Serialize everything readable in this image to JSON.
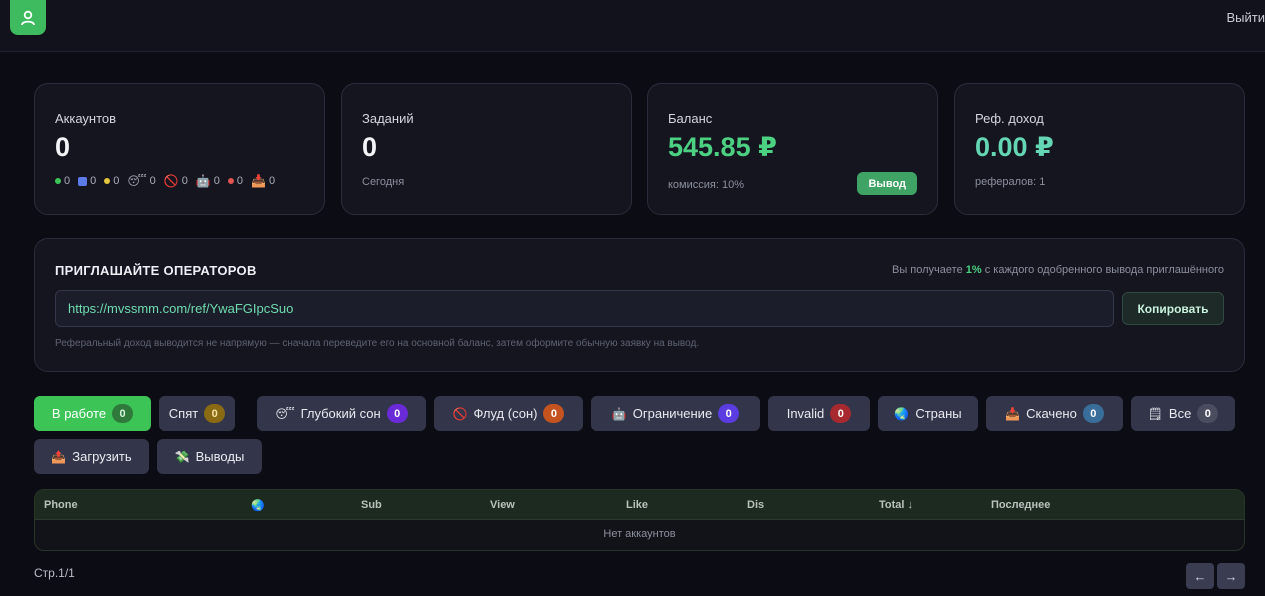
{
  "header": {
    "logout_label": "Выйти"
  },
  "stats": {
    "accounts": {
      "label": "Аккаунтов",
      "value": "0",
      "mini": [
        {
          "icon": "green-dot",
          "color": "#3cc457",
          "count": "0"
        },
        {
          "icon": "blue-square-icon",
          "count": "0"
        },
        {
          "icon": "yellow-dot",
          "color": "#e6c63d",
          "count": "0"
        },
        {
          "icon": "sleepy-face-icon",
          "count": "0"
        },
        {
          "icon": "prohibited-icon",
          "count": "0"
        },
        {
          "icon": "robot-face-icon",
          "count": "0"
        },
        {
          "icon": "red-dot",
          "color": "#e0554f",
          "count": "0"
        },
        {
          "icon": "inbox-tray-icon",
          "count": "0"
        }
      ]
    },
    "tasks": {
      "label": "Заданий",
      "value": "0",
      "sub": "Сегодня"
    },
    "balance": {
      "label": "Баланс",
      "value": "545.85 ₽",
      "sub": "комиссия: 10%",
      "withdraw_label": "Вывод"
    },
    "ref_income": {
      "label": "Реф. доход",
      "value": "0.00 ₽",
      "sub": "рефералов: 1"
    }
  },
  "invite": {
    "title": "ПРИГЛАШАЙТЕ ОПЕРАТОРОВ",
    "note_prefix": "Вы получаете ",
    "note_percent": "1%",
    "note_suffix": " с каждого одобренного вывода приглашённого",
    "ref_link": "https://mvssmm.com/ref/YwaFGIpcSuo",
    "copy_label": "Копировать",
    "hint": "Реферальный доход выводится не напрямую — сначала переведите его на основной баланс, затем оформите обычную заявку на вывод."
  },
  "filters": [
    {
      "label": "В работе",
      "count": "0"
    },
    {
      "label": "Спят",
      "count": "0"
    },
    {
      "label": "Глубокий сон",
      "count": "0",
      "icon": "sleepy-face-icon"
    },
    {
      "label": "Флуд (сон)",
      "count": "0",
      "icon": "prohibited-icon"
    },
    {
      "label": "Ограничение",
      "count": "0",
      "icon": "robot-face-icon"
    },
    {
      "label": "Invalid",
      "count": "0"
    },
    {
      "label": "Страны",
      "icon": "globe-icon"
    },
    {
      "label": "Скачено",
      "count": "0",
      "icon": "inbox-tray-icon"
    },
    {
      "label": "Все",
      "count": "0",
      "icon": "clipboard-icon"
    },
    {
      "label": "Загрузить",
      "icon": "outbox-tray-icon"
    },
    {
      "label": "Выводы",
      "icon": "money-wings-icon"
    }
  ],
  "badge_colors": {
    "active": "#2f7a3b",
    "sleep": "#8a6a12",
    "deep": "#6a2ad8",
    "flood": "#c4531f",
    "limit": "#5a3ce0",
    "invalid": "#a8282f",
    "downloaded": "#3a6e9a",
    "all": "#4a4d60"
  },
  "table": {
    "columns": [
      "Phone",
      "",
      "Sub",
      "View",
      "Like",
      "Dis",
      "Total ↓",
      "Последнее"
    ],
    "empty": "Нет аккаунтов"
  },
  "pager": {
    "label": "Стр.1/1",
    "prev": "←",
    "next": "→"
  }
}
